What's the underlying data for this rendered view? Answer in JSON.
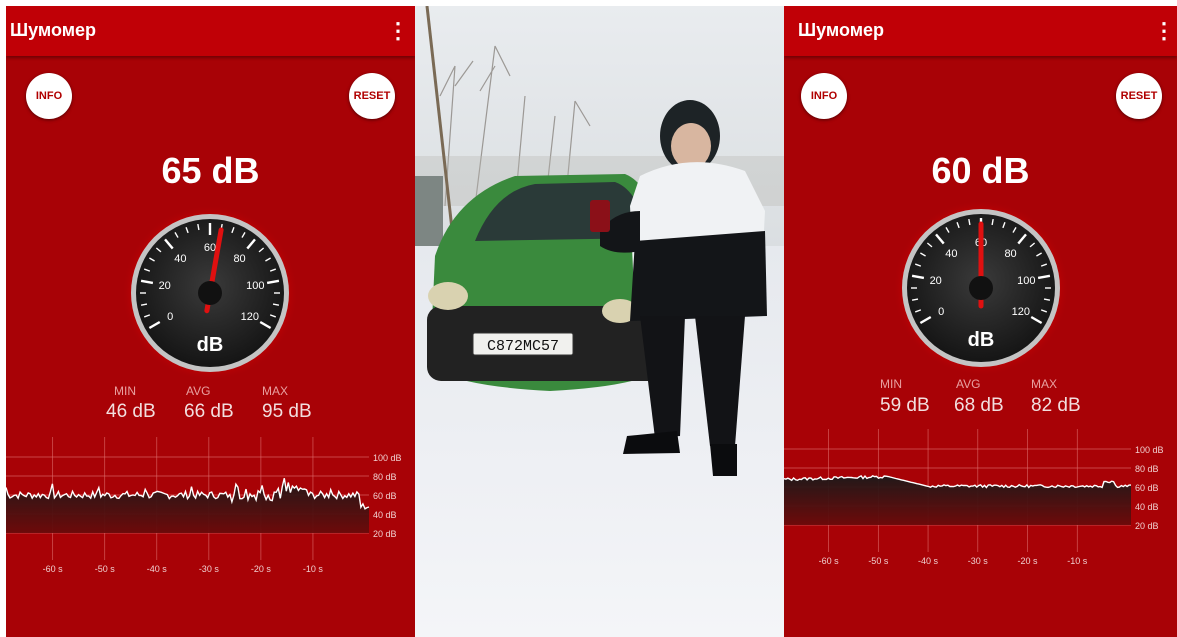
{
  "left": {
    "app_title": "Шумомер",
    "menu_icon": "more-vertical-icon",
    "info_label": "INFO",
    "reset_label": "RESET",
    "current_value": 65,
    "current_display": "65 dB",
    "gauge_unit": "dB",
    "gauge_ticks": [
      "0",
      "20",
      "40",
      "60",
      "80",
      "100",
      "120"
    ],
    "stats": {
      "min_label": "MIN",
      "min_value": "46 dB",
      "avg_label": "AVG",
      "avg_value": "66 dB",
      "max_label": "MAX",
      "max_value": "95 dB"
    },
    "graph": {
      "y_labels": [
        "100 dB",
        "80 dB",
        "60 dB",
        "40 dB",
        "20 dB"
      ],
      "x_labels": [
        "-60 s",
        "-50 s",
        "-40 s",
        "-30 s",
        "-20 s",
        "-10 s"
      ]
    }
  },
  "right": {
    "app_title": "Шумомер",
    "menu_icon": "more-vertical-icon",
    "info_label": "INFO",
    "reset_label": "RESET",
    "current_value": 60,
    "current_display": "60 dB",
    "gauge_unit": "dB",
    "gauge_ticks": [
      "0",
      "20",
      "40",
      "60",
      "80",
      "100",
      "120"
    ],
    "stats": {
      "min_label": "MIN",
      "min_value": "59 dB",
      "avg_label": "AVG",
      "avg_value": "68 dB",
      "max_label": "MAX",
      "max_value": "82 dB"
    },
    "graph": {
      "y_labels": [
        "100 dB",
        "80 dB",
        "60 dB",
        "40 dB",
        "20 dB"
      ],
      "x_labels": [
        "-60 s",
        "-50 s",
        "-40 s",
        "-30 s",
        "-20 s",
        "-10 s"
      ]
    }
  },
  "photo": {
    "plate_text": "С872МС57"
  },
  "colors": {
    "panel_bg": "#a80206",
    "appbar": "#c00006",
    "needle": "#e01010"
  }
}
